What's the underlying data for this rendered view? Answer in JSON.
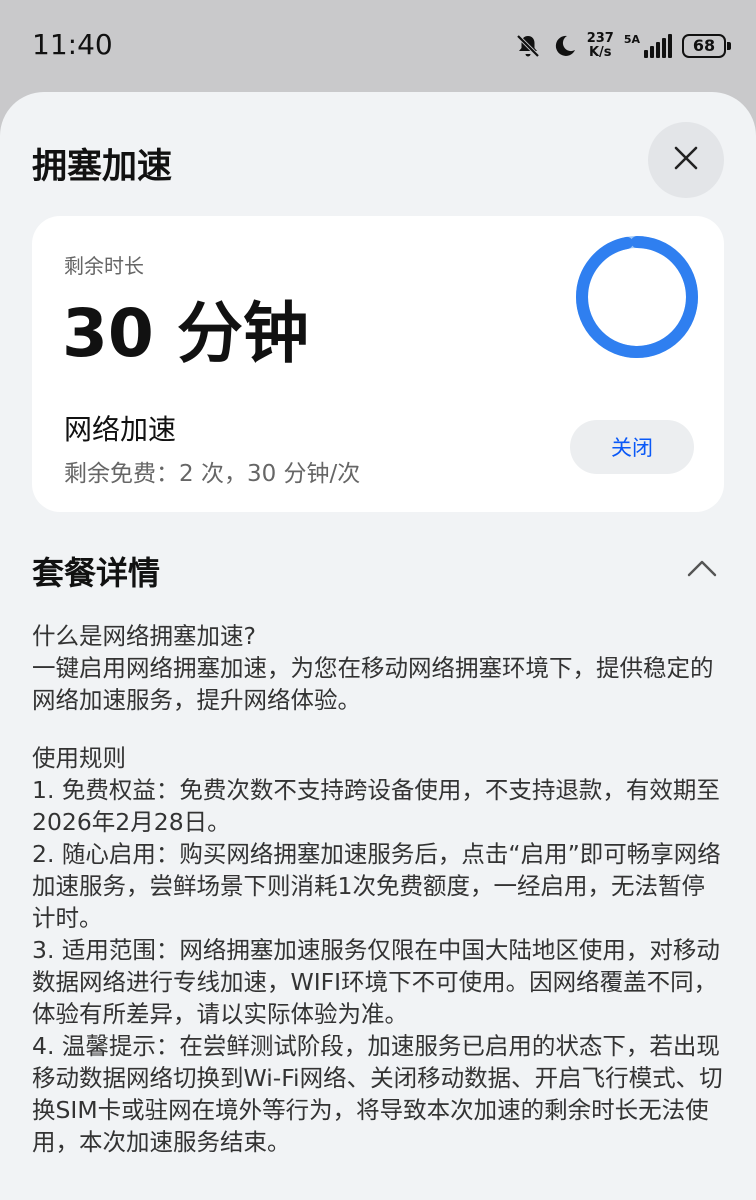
{
  "status_bar": {
    "time": "11:40",
    "net_speed_value": "237",
    "net_speed_unit": "K/s",
    "signal_label": "5A",
    "battery": "68"
  },
  "sheet": {
    "title": "拥塞加速"
  },
  "card": {
    "remain_label": "剩余时长",
    "remain_value": "30 分钟",
    "remaining_fraction": 0.97,
    "accel_title": "网络加速",
    "accel_sub": "剩余免费：2 次，30 分钟/次",
    "toggle_label": "关闭"
  },
  "package": {
    "title": "套餐详情",
    "what_title": "什么是网络拥塞加速?",
    "what_body": "一键启用网络拥塞加速，为您在移动网络拥塞环境下，提供稳定的网络加速服务，提升网络体验。",
    "rules_title": "使用规则",
    "rules": [
      "1. 免费权益：免费次数不支持跨设备使用，不支持退款，有效期至2026年2月28日。",
      "2. 随心启用：购买网络拥塞加速服务后，点击“启用”即可畅享网络加速服务，尝鲜场景下则消耗1次免费额度，一经启用，无法暂停计时。",
      "3. 适用范围：网络拥塞加速服务仅限在中国大陆地区使用，对移动数据网络进行专线加速，WIFI环境下不可使用。因网络覆盖不同，体验有所差异，请以实际体验为准。",
      "4. 温馨提示：在尝鲜测试阶段，加速服务已启用的状态下，若出现移动数据网络切换到Wi-Fi网络、关闭移动数据、开启飞行模式、切换SIM卡或驻网在境外等行为，将导致本次加速的剩余时长无法使用，本次加速服务结束。"
    ]
  },
  "colors": {
    "accent": "#0a59f7",
    "ring_main": "#2f7ff0",
    "ring_light": "#9cc6f8"
  }
}
